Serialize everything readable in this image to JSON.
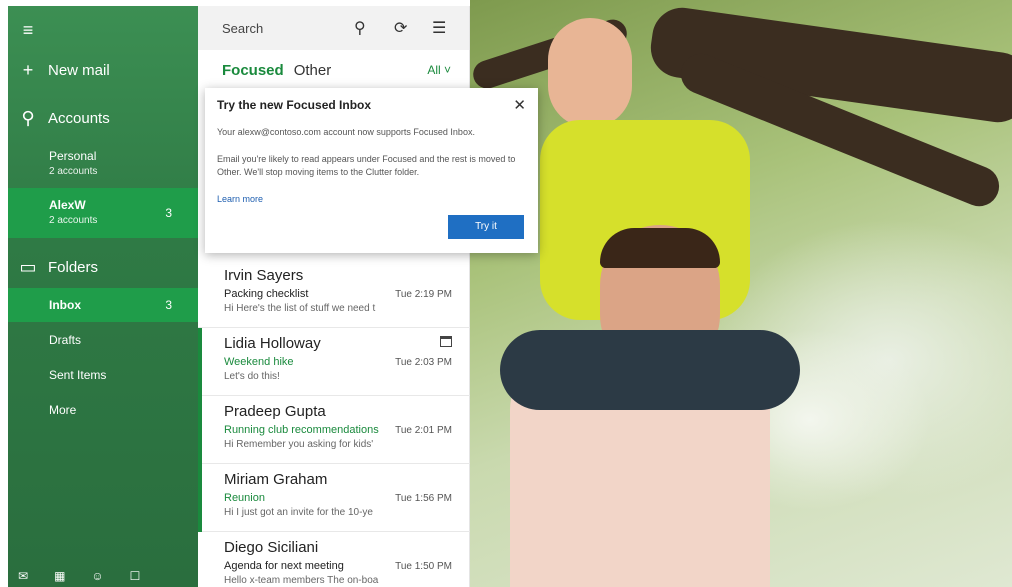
{
  "nav": {
    "new_mail": "New mail",
    "accounts": "Accounts",
    "accounts_list": [
      {
        "name": "Personal",
        "sub": "2 accounts",
        "count": ""
      },
      {
        "name": "AlexW",
        "sub": "2 accounts",
        "count": "3"
      }
    ],
    "folders": "Folders",
    "folders_list": [
      {
        "name": "Inbox",
        "count": "3"
      },
      {
        "name": "Drafts",
        "count": ""
      },
      {
        "name": "Sent Items",
        "count": ""
      },
      {
        "name": "More",
        "count": ""
      }
    ]
  },
  "list": {
    "search_placeholder": "Search",
    "tab_focused": "Focused",
    "tab_other": "Other",
    "filter": "All ˅",
    "messages": [
      {
        "sender": "Irvin Sayers",
        "subject": "Packing checklist",
        "time": "Tue 2:19 PM",
        "preview": "Hi Here's the list of stuff we need t"
      },
      {
        "sender": "Lidia Holloway",
        "subject": "Weekend hike",
        "time": "Tue 2:03 PM",
        "preview": "Let's do this!"
      },
      {
        "sender": "Pradeep Gupta",
        "subject": "Running club recommendations",
        "time": "Tue 2:01 PM",
        "preview": "Hi Remember you asking for kids'"
      },
      {
        "sender": "Miriam Graham",
        "subject": "Reunion",
        "time": "Tue 1:56 PM",
        "preview": "Hi I just got an invite for the 10-ye"
      },
      {
        "sender": "Diego Siciliani",
        "subject": "Agenda for next meeting",
        "time": "Tue 1:50 PM",
        "preview": "Hello x-team members The on-boa"
      }
    ]
  },
  "popup": {
    "title": "Try the new Focused Inbox",
    "line1": "Your alexw@contoso.com account now supports Focused Inbox.",
    "line2": "Email you're likely to read appears under Focused and the rest is moved to Other. We'll stop moving items to the Clutter folder.",
    "link": "Learn more",
    "button": "Try it"
  },
  "colors": {
    "accent": "#1a8a3d",
    "nav": "#2f7a45",
    "button": "#1f6fc3"
  }
}
